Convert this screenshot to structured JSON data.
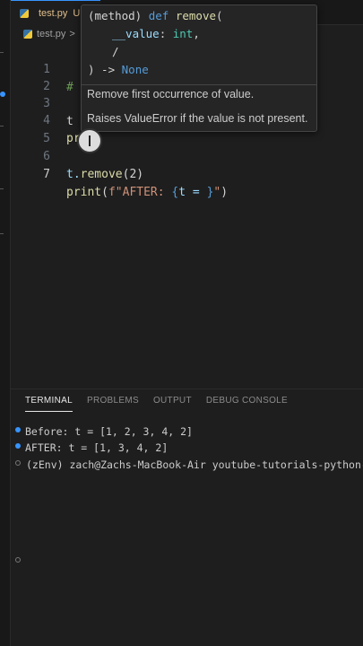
{
  "tab": {
    "filename": "test.py",
    "status": "U"
  },
  "breadcrumb": {
    "file": "test.py",
    "sep": ">"
  },
  "lines": [
    {
      "num": "1",
      "code": "#"
    },
    {
      "num": "2",
      "code": ""
    },
    {
      "num": "3",
      "code": "t"
    },
    {
      "num": "4",
      "code": "pr"
    },
    {
      "num": "5",
      "code": ""
    },
    {
      "num": "6",
      "code_prefix": "t.",
      "code_method": "remove",
      "code_args": "(2)"
    },
    {
      "num": "7",
      "code_fn": "print",
      "code_open": "(",
      "code_fstr_start": "f\"AFTER: ",
      "code_brace_open": "{",
      "code_var": "t = ",
      "code_brace_close": "}",
      "code_fstr_end": "\"",
      "code_close": ")"
    }
  ],
  "hover": {
    "sig_line1_kw": "(method)",
    "sig_line1_def": "def",
    "sig_line1_name": "remove",
    "sig_line1_open": "(",
    "sig_line2_param": "__value",
    "sig_line2_colon": ": ",
    "sig_line2_type": "int",
    "sig_line2_comma": ",",
    "sig_line3": "/",
    "sig_line4_close": ") -> ",
    "sig_line4_ret": "None",
    "doc1": "Remove first occurrence of value.",
    "doc2": "Raises ValueError if the value is not present."
  },
  "panel": {
    "tabs": [
      "TERMINAL",
      "PROBLEMS",
      "OUTPUT",
      "DEBUG CONSOLE"
    ]
  },
  "terminal": {
    "line1": "Before: t = [1, 2, 3, 4, 2]",
    "line2": "AFTER: t = [1, 3, 4, 2]",
    "line3": "(zEnv) zach@Zachs-MacBook-Air youtube-tutorials-python-ba"
  },
  "colors": {
    "accent": "#3794ff",
    "modified": "#e2c08d"
  }
}
